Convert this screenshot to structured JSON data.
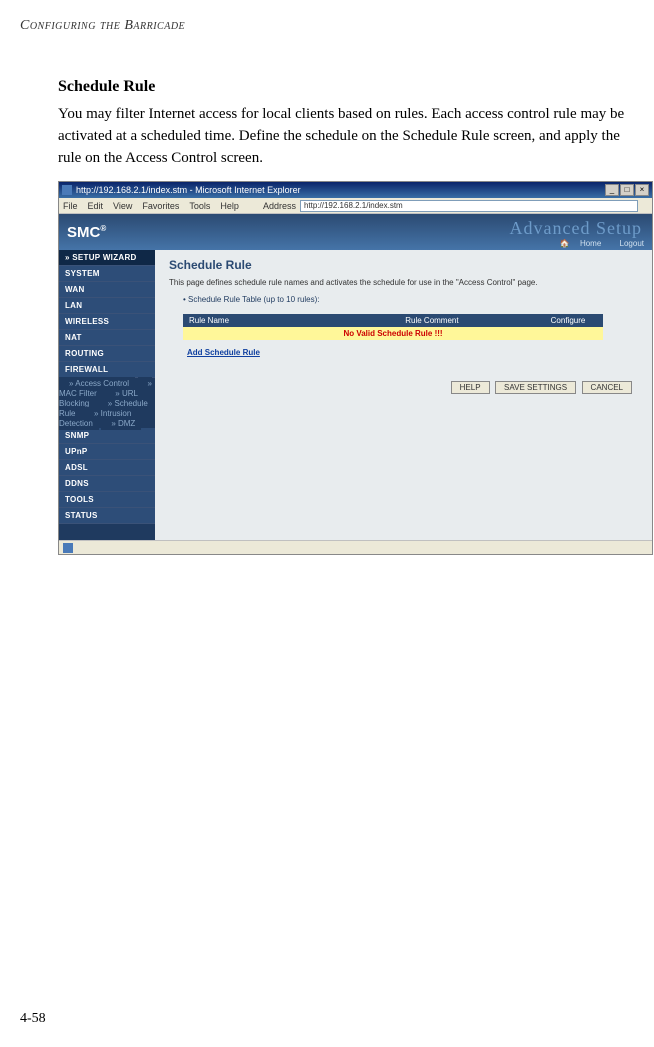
{
  "running_header": "Configuring the Barricade",
  "section_title": "Schedule Rule",
  "body_text": "You may filter Internet access for local clients based on rules. Each access control rule may be activated at a scheduled time. Define the schedule on the Schedule Rule screen, and apply the rule on the Access Control screen.",
  "page_number": "4-58",
  "screenshot": {
    "window_title": "http://192.168.2.1/index.stm - Microsoft Internet Explorer",
    "menu": {
      "file": "File",
      "edit": "Edit",
      "view": "View",
      "favorites": "Favorites",
      "tools": "Tools",
      "help": "Help"
    },
    "address_label": "Address",
    "address_value": "http://192.168.2.1/index.stm",
    "logo": "SMC",
    "banner_title": "Advanced Setup",
    "home_link": "Home",
    "logout_link": "Logout",
    "sidebar": {
      "setup": "» SETUP WIZARD",
      "items": [
        "SYSTEM",
        "WAN",
        "LAN",
        "WIRELESS",
        "NAT",
        "ROUTING",
        "FIREWALL"
      ],
      "subitems": [
        "» Access Control",
        "» MAC Filter",
        "» URL Blocking",
        "» Schedule Rule",
        "» Intrusion Detection",
        "» DMZ"
      ],
      "items2": [
        "SNMP",
        "UPnP",
        "ADSL",
        "DDNS",
        "TOOLS",
        "STATUS"
      ]
    },
    "panel": {
      "title": "Schedule Rule",
      "desc": "This page defines schedule rule names and activates the schedule for use in the \"Access Control\" page.",
      "sub": "• Schedule Rule Table (up to 10 rules):",
      "col_name": "Rule Name",
      "col_comment": "Rule Comment",
      "col_conf": "Configure",
      "empty_msg": "No Valid Schedule Rule !!!",
      "add_link": "Add Schedule Rule",
      "help_btn": "HELP",
      "save_btn": "SAVE SETTINGS",
      "cancel_btn": "CANCEL"
    }
  }
}
